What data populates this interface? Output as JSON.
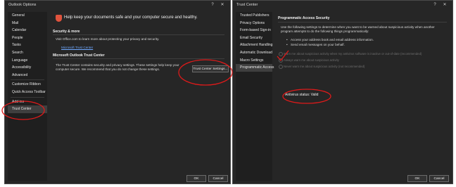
{
  "outlook_options": {
    "title": "Outlook Options",
    "help_glyph": "?",
    "close_glyph": "✕",
    "nav_items": [
      "General",
      "Mail",
      "Calendar",
      "People",
      "Tasks",
      "Search",
      "Language",
      "Accessibility",
      "Advanced",
      "Customize Ribbon",
      "Quick Access Toolbar",
      "Add-ins",
      "Trust Center"
    ],
    "active_item": "Trust Center",
    "headline": "Help keep your documents safe and your computer secure and healthy.",
    "security_heading": "Security & more",
    "security_text": "Visit Office.com to learn more about protecting your privacy and security.",
    "security_link": "Microsoft Trust Center",
    "trust_heading": "Microsoft Outlook Trust Center",
    "trust_text": "The Trust Center contains security and privacy settings. These settings help keep your computer secure. We recommend that you do not change these settings.",
    "trust_button": "Trust Center Settings...",
    "ok_label": "OK",
    "cancel_label": "Cancel",
    "accent_color": "#e0533d"
  },
  "trust_center": {
    "title": "Trust Center",
    "help_glyph": "?",
    "close_glyph": "✕",
    "nav_items": [
      "Trusted Publishers",
      "Privacy Options",
      "Form-based Sign-in",
      "Email Security",
      "Attachment Handling",
      "Automatic Download",
      "Macro Settings",
      "Programmatic Access"
    ],
    "active_item": "Programmatic Access",
    "heading": "Programmatic Access Security",
    "intro": "Use the following settings to determine when you want to be warned about suspicious activity when another program attempts to do the following things programmatically:",
    "bullets": [
      "Access your address book and email address information.",
      "Send email messages on your behalf."
    ],
    "options": [
      "Warn me about suspicious activity when my antivirus software is inactive or out-of-date (recommended)",
      "Always warn me about suspicious activity",
      "Never warn me about suspicious activity (not recommended)"
    ],
    "antivirus_status": "Antivirus status: Valid",
    "ok_label": "OK",
    "cancel_label": "Cancel"
  }
}
